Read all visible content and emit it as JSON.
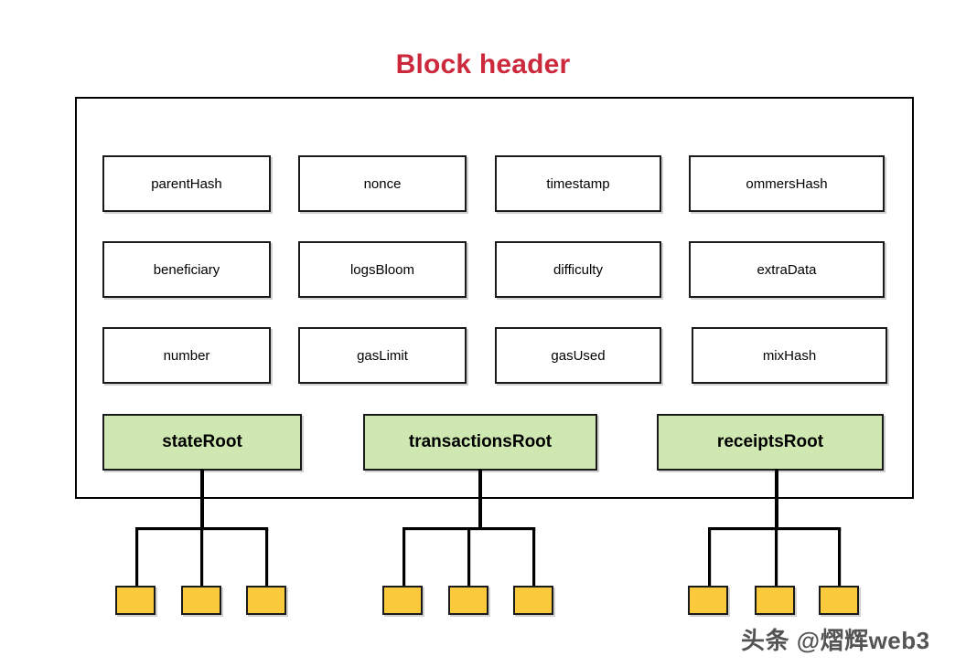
{
  "diagram": {
    "title": "Block header",
    "title_color": "#cc2a3c",
    "container_border_color": "#000000",
    "field_rows": [
      [
        {
          "label": "parentHash"
        },
        {
          "label": "nonce"
        },
        {
          "label": "timestamp"
        },
        {
          "label": "ommersHash"
        }
      ],
      [
        {
          "label": "beneficiary"
        },
        {
          "label": "logsBloom"
        },
        {
          "label": "difficulty"
        },
        {
          "label": "extraData"
        }
      ],
      [
        {
          "label": "number"
        },
        {
          "label": "gasLimit"
        },
        {
          "label": "gasUsed"
        },
        {
          "label": "mixHash"
        }
      ]
    ],
    "root_fields": [
      {
        "label": "stateRoot",
        "fill": "#cfe8b1",
        "leaf_count": 3
      },
      {
        "label": "transactionsRoot",
        "fill": "#cfe8b1",
        "leaf_count": 3
      },
      {
        "label": "receiptsRoot",
        "fill": "#cfe8b1",
        "leaf_count": 3
      }
    ],
    "leaf_fill": "#fbc93c"
  },
  "watermark": {
    "text": "头条 @熠辉web3"
  }
}
